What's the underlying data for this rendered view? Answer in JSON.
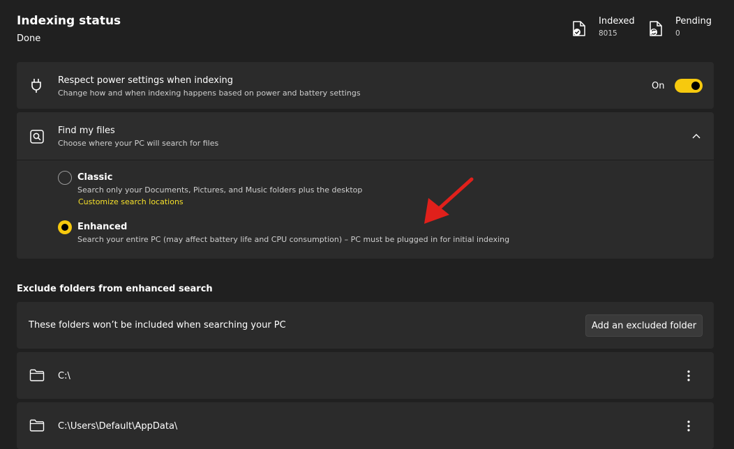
{
  "header": {
    "title": "Indexing status",
    "status": "Done",
    "indexed_label": "Indexed",
    "indexed_value": "8015",
    "pending_label": "Pending",
    "pending_value": "0"
  },
  "power": {
    "title": "Respect power settings when indexing",
    "description": "Change how and when indexing happens based on power and battery settings",
    "toggle_label": "On",
    "toggle_on": true
  },
  "find_files": {
    "title": "Find my files",
    "description": "Choose where your PC will search for files",
    "options": [
      {
        "title": "Classic",
        "description": "Search only your Documents, Pictures, and Music folders plus the desktop",
        "link": "Customize search locations",
        "selected": false
      },
      {
        "title": "Enhanced",
        "description": "Search your entire PC (may affect battery life and CPU consumption) – PC must be plugged in for initial indexing",
        "selected": true
      }
    ]
  },
  "exclude": {
    "heading": "Exclude folders from enhanced search",
    "info_text": "These folders won’t be included when searching your PC",
    "add_button": "Add an excluded folder",
    "folders": [
      "C:\\",
      "C:\\Users\\Default\\AppData\\"
    ]
  },
  "colors": {
    "accent": "#f6c90e",
    "background": "#202020",
    "card": "#2b2b2b",
    "annotation_arrow": "#e0201b"
  },
  "icons": {
    "indexed": "file-check-icon",
    "pending": "file-sync-icon",
    "power": "power-plug-icon",
    "find": "search-document-icon",
    "collapse": "chevron-up-icon",
    "folder": "folder-icon",
    "more": "more-vertical-icon"
  }
}
